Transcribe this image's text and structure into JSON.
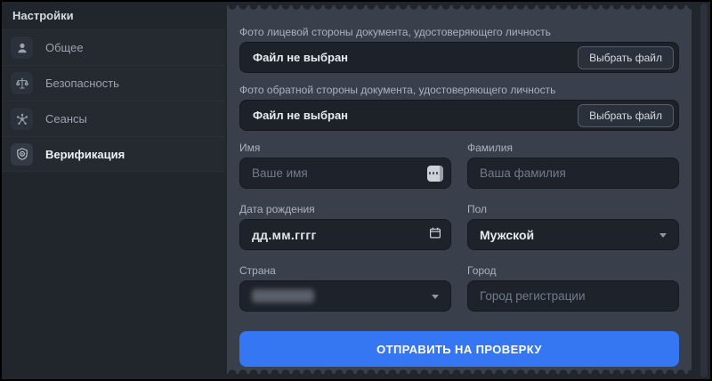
{
  "sidebar": {
    "title": "Настройки",
    "items": [
      {
        "label": "Общее",
        "icon": "user-icon",
        "active": false
      },
      {
        "label": "Безопасность",
        "icon": "scales-icon",
        "active": false
      },
      {
        "label": "Сеансы",
        "icon": "sessions-icon",
        "active": false
      },
      {
        "label": "Верификация",
        "icon": "shield-icon",
        "active": true
      }
    ]
  },
  "form": {
    "file_fields": [
      {
        "label": "Фото лицевой стороны документа, удостоверяющего личность",
        "value": "Файл не выбран",
        "button": "Выбрать файл"
      },
      {
        "label": "Фото обратной стороны документа, удостоверяющего личность",
        "value": "Файл не выбран",
        "button": "Выбрать файл"
      }
    ],
    "first_name": {
      "label": "Имя",
      "placeholder": "Ваше имя"
    },
    "last_name": {
      "label": "Фамилия",
      "placeholder": "Ваша фамилия"
    },
    "birth_date": {
      "label": "Дата рождения",
      "value": "дд.мм.гггг"
    },
    "gender": {
      "label": "Пол",
      "value": "Мужской"
    },
    "country": {
      "label": "Страна",
      "value": "",
      "note": "value blurred/redacted in screenshot"
    },
    "city": {
      "label": "Город",
      "placeholder": "Город регистрации"
    },
    "submit_label": "ОТПРАВИТЬ НА ПРОВЕРКУ"
  },
  "colors": {
    "page_bg": "#21252c",
    "card_bg": "#3a404b",
    "input_bg": "#1e222a",
    "accent_blue": "#3577f3",
    "label_text": "#a9b2bf",
    "value_text": "#e8ecf1"
  }
}
